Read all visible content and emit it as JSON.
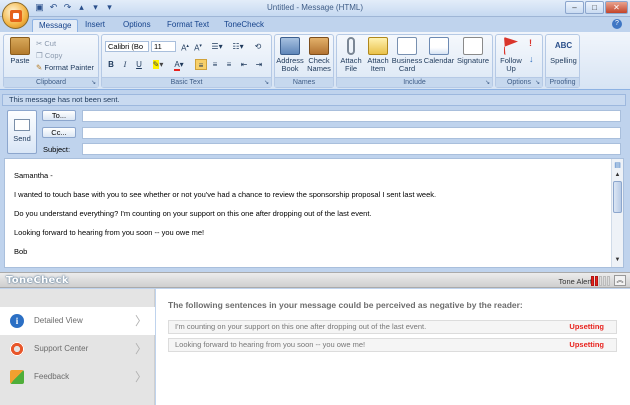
{
  "window": {
    "title": "Untitled - Message (HTML)"
  },
  "tabs": [
    {
      "label": "Message"
    },
    {
      "label": "Insert"
    },
    {
      "label": "Options"
    },
    {
      "label": "Format Text"
    },
    {
      "label": "ToneCheck"
    }
  ],
  "ribbon": {
    "clipboard": {
      "label": "Clipboard",
      "paste": "Paste",
      "cut": "Cut",
      "copy": "Copy",
      "format_painter": "Format Painter"
    },
    "basic_text": {
      "label": "Basic Text",
      "font": "Calibri (Bo",
      "size": "11"
    },
    "names": {
      "label": "Names",
      "address_book": "Address Book",
      "check_names": "Check Names"
    },
    "include": {
      "label": "Include",
      "attach_file": "Attach File",
      "attach_item": "Attach Item",
      "business_card": "Business Card",
      "calendar": "Calendar",
      "signature": "Signature"
    },
    "options": {
      "label": "Options",
      "follow_up": "Follow Up"
    },
    "proofing": {
      "label": "Proofing",
      "spelling": "Spelling"
    }
  },
  "infobar": "This message has not been sent.",
  "compose": {
    "send": "Send",
    "to": "To...",
    "cc": "Cc...",
    "subject": "Subject:"
  },
  "body": [
    "Samantha -",
    "I wanted to touch base with you to see whether or not you've had a chance to review the sponsorship proposal I sent last week.",
    "Do you understand everything? I'm counting on your support on this one after dropping out of the last event.",
    "Looking forward to hearing from you soon -- you owe me!",
    "Bob"
  ],
  "tonecheck": {
    "logo": "ToneCheck",
    "alert_label": "Tone Alert:",
    "alert_level": "2 of 5",
    "sidebar": [
      {
        "label": "Detailed View"
      },
      {
        "label": "Support Center"
      },
      {
        "label": "Feedback"
      }
    ],
    "heading": "The following sentences in your message could be perceived as negative by the reader:",
    "results": [
      {
        "text": "I'm counting on your support on this one after dropping out of the last event.",
        "label": "Upsetting"
      },
      {
        "text": "Looking forward to hearing from you soon -- you owe me!",
        "label": "Upsetting"
      }
    ]
  },
  "colors": {
    "ribbon_blue": "#bfd3ed",
    "upsetting": "#e8231e",
    "brand": "#15428b"
  }
}
